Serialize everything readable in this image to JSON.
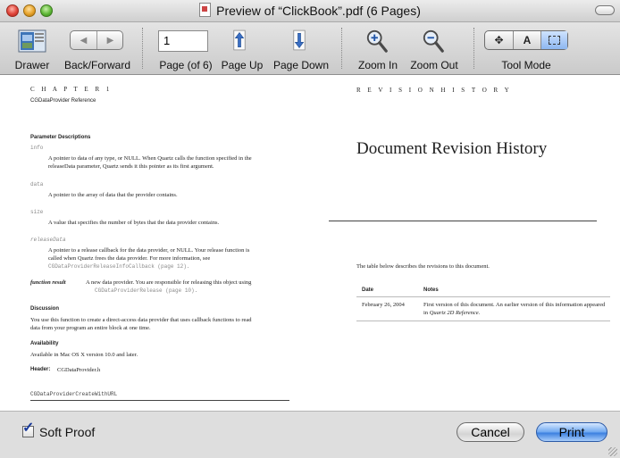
{
  "window": {
    "title": "Preview of “ClickBook”.pdf (6 Pages)"
  },
  "toolbar": {
    "drawer_label": "Drawer",
    "back_forward_label": "Back/Forward",
    "page_field_value": "1",
    "page_label": "Page (of 6)",
    "page_up_label": "Page Up",
    "page_down_label": "Page Down",
    "zoom_in_label": "Zoom In",
    "zoom_out_label": "Zoom Out",
    "tool_mode_label": "Tool Mode",
    "tool_mode_text_glyph": "A"
  },
  "left_page": {
    "eyebrow": "C H A P T E R   1",
    "subtitle": "CGDataProvider Reference",
    "param_heading": "Parameter Descriptions",
    "param_info_name": "info",
    "param_info_desc1": "A pointer to data of any type, or NULL. When Quartz calls the function specified in the",
    "param_info_desc2": "releaseData parameter, Quartz sends it this pointer as its first argument.",
    "param_data_name": "data",
    "param_data_desc": "A pointer to the array of data that the provider contains.",
    "param_size_name": "size",
    "param_size_desc": "A value that specifies the number of bytes that the data provider contains.",
    "param_release_name": "releaseData",
    "param_release_desc1": "A pointer to a release callback for the data provider, or NULL. Your release function is",
    "param_release_desc2": "called when Quartz frees the data provider. For more information, see",
    "param_release_desc3": "CGDataProviderReleaseInfoCallback (page 12).",
    "function_result_label": "function result",
    "function_result_desc1": "A new data provider. You are responsible for releasing this object using",
    "function_result_desc2": "CGDataProviderRelease (page 10).",
    "discussion_heading": "Discussion",
    "discussion_text1": "You use this function to create a direct-access data provider that uses callback functions to read",
    "discussion_text2": "data from your program an entire block at one time.",
    "availability_heading": "Availability",
    "availability_text": "Available in Mac OS X version 10.0 and later.",
    "header_label": "Header:",
    "header_value": "CGDataProvider.h",
    "next_function": "CGDataProviderCreateWithURL"
  },
  "right_page": {
    "eyebrow": "R E V I S I O N   H I S T O R Y",
    "title": "Document Revision History",
    "intro": "The table below describes the revisions to this document.",
    "col_date": "Date",
    "col_notes": "Notes",
    "row_date": "February 26, 2004",
    "row_notes1": "First version of this document. An earlier version of this information appeared",
    "row_notes2_prefix": "in",
    "row_notes2_ref": "Quartz 2D Reference."
  },
  "bottom": {
    "soft_proof_label": "Soft Proof",
    "soft_proof_checked": "✓",
    "cancel_label": "Cancel",
    "print_label": "Print"
  },
  "colors": {
    "accent": "#3b7fe0",
    "toolbar_top": "#e4e4e4",
    "toolbar_bottom": "#cacaca"
  }
}
